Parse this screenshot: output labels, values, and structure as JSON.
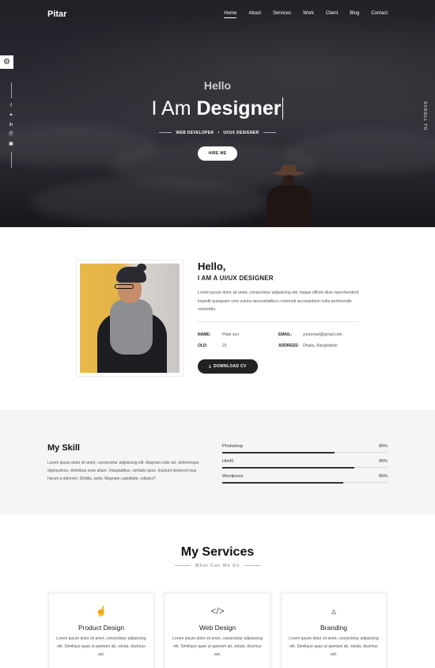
{
  "nav": {
    "logo": "Pitar",
    "items": [
      "Home",
      "About",
      "Services",
      "Work",
      "Client",
      "Blog",
      "Contact"
    ],
    "active": "Home"
  },
  "hero": {
    "greeting": "Hello",
    "title_prefix": "I Am",
    "title_bold": "Designer",
    "role_1": "WEB DEVELOPER",
    "role_sep": "•",
    "role_2": "UI/UX DESIGNER",
    "cta": "HIRE ME",
    "scroll_text": "SCROLL TO"
  },
  "social_icons": [
    "facebook-icon",
    "twitter-icon",
    "linkedin-icon",
    "pinterest-icon",
    "instagram-icon"
  ],
  "about": {
    "heading": "Hello,",
    "role": "I AM A UI/UX DESIGNER",
    "text": "Lorem ipsum dolor sit amet, consectetur adipisicing elit. Itaque officiis illum reprehenderit impedit quisquam vero soluta necessitatibus commodi accusantium nulla perferendis reiciendis.",
    "info": {
      "name_label": "NAME:",
      "name_value": "Pitan son",
      "email_label": "EMAIL:",
      "email_value": "youremail@gmail.com",
      "old_label": "OLD:",
      "old_value": "23",
      "address_label": "ADDRESS:",
      "address_value": "Dhaka, Bangladesh"
    },
    "download": "DOWNLOAD CV"
  },
  "skill": {
    "title": "My Skill",
    "text": "Lorem ipsum dolor sit amet, consectetur adipisicing elit. Magnam odio vel, doloremque dignissimos, doloribus esse ullam. Voluptatibus, veritatis quos. Incidunt deserunt eius harum a dolorem. Debitis, optio. Magnam cupiditate, odipisci?",
    "items": [
      {
        "label": "Photoshop",
        "value": "80%",
        "level": 0.68
      },
      {
        "label": "Html5",
        "value": "95%",
        "level": 0.8
      },
      {
        "label": "Wordpress",
        "value": "85%",
        "level": 0.73
      }
    ]
  },
  "services": {
    "title": "My Services",
    "subtitle": "What Can We Do",
    "cards": [
      {
        "icon": "hand-pointer-icon",
        "title": "Product Design",
        "text": "Lorem ipsum dolor sit amet, consectetur adipisicing elit. Similique quae ut aperiam ab, soluta, ducimus aut."
      },
      {
        "icon": "code-icon",
        "title": "Web Design",
        "text": "Lorem ipsum dolor sit amet, consectetur adipisicing elit. Similique quae ut aperiam ab, soluta, ducimus aut."
      },
      {
        "icon": "broadcast-tower-icon",
        "title": "Branding",
        "text": "Lorem ipsum dolor sit amet, consectetur adipisicing elit. Similique quae ut aperiam ab, soluta, ducimus aut."
      }
    ]
  }
}
